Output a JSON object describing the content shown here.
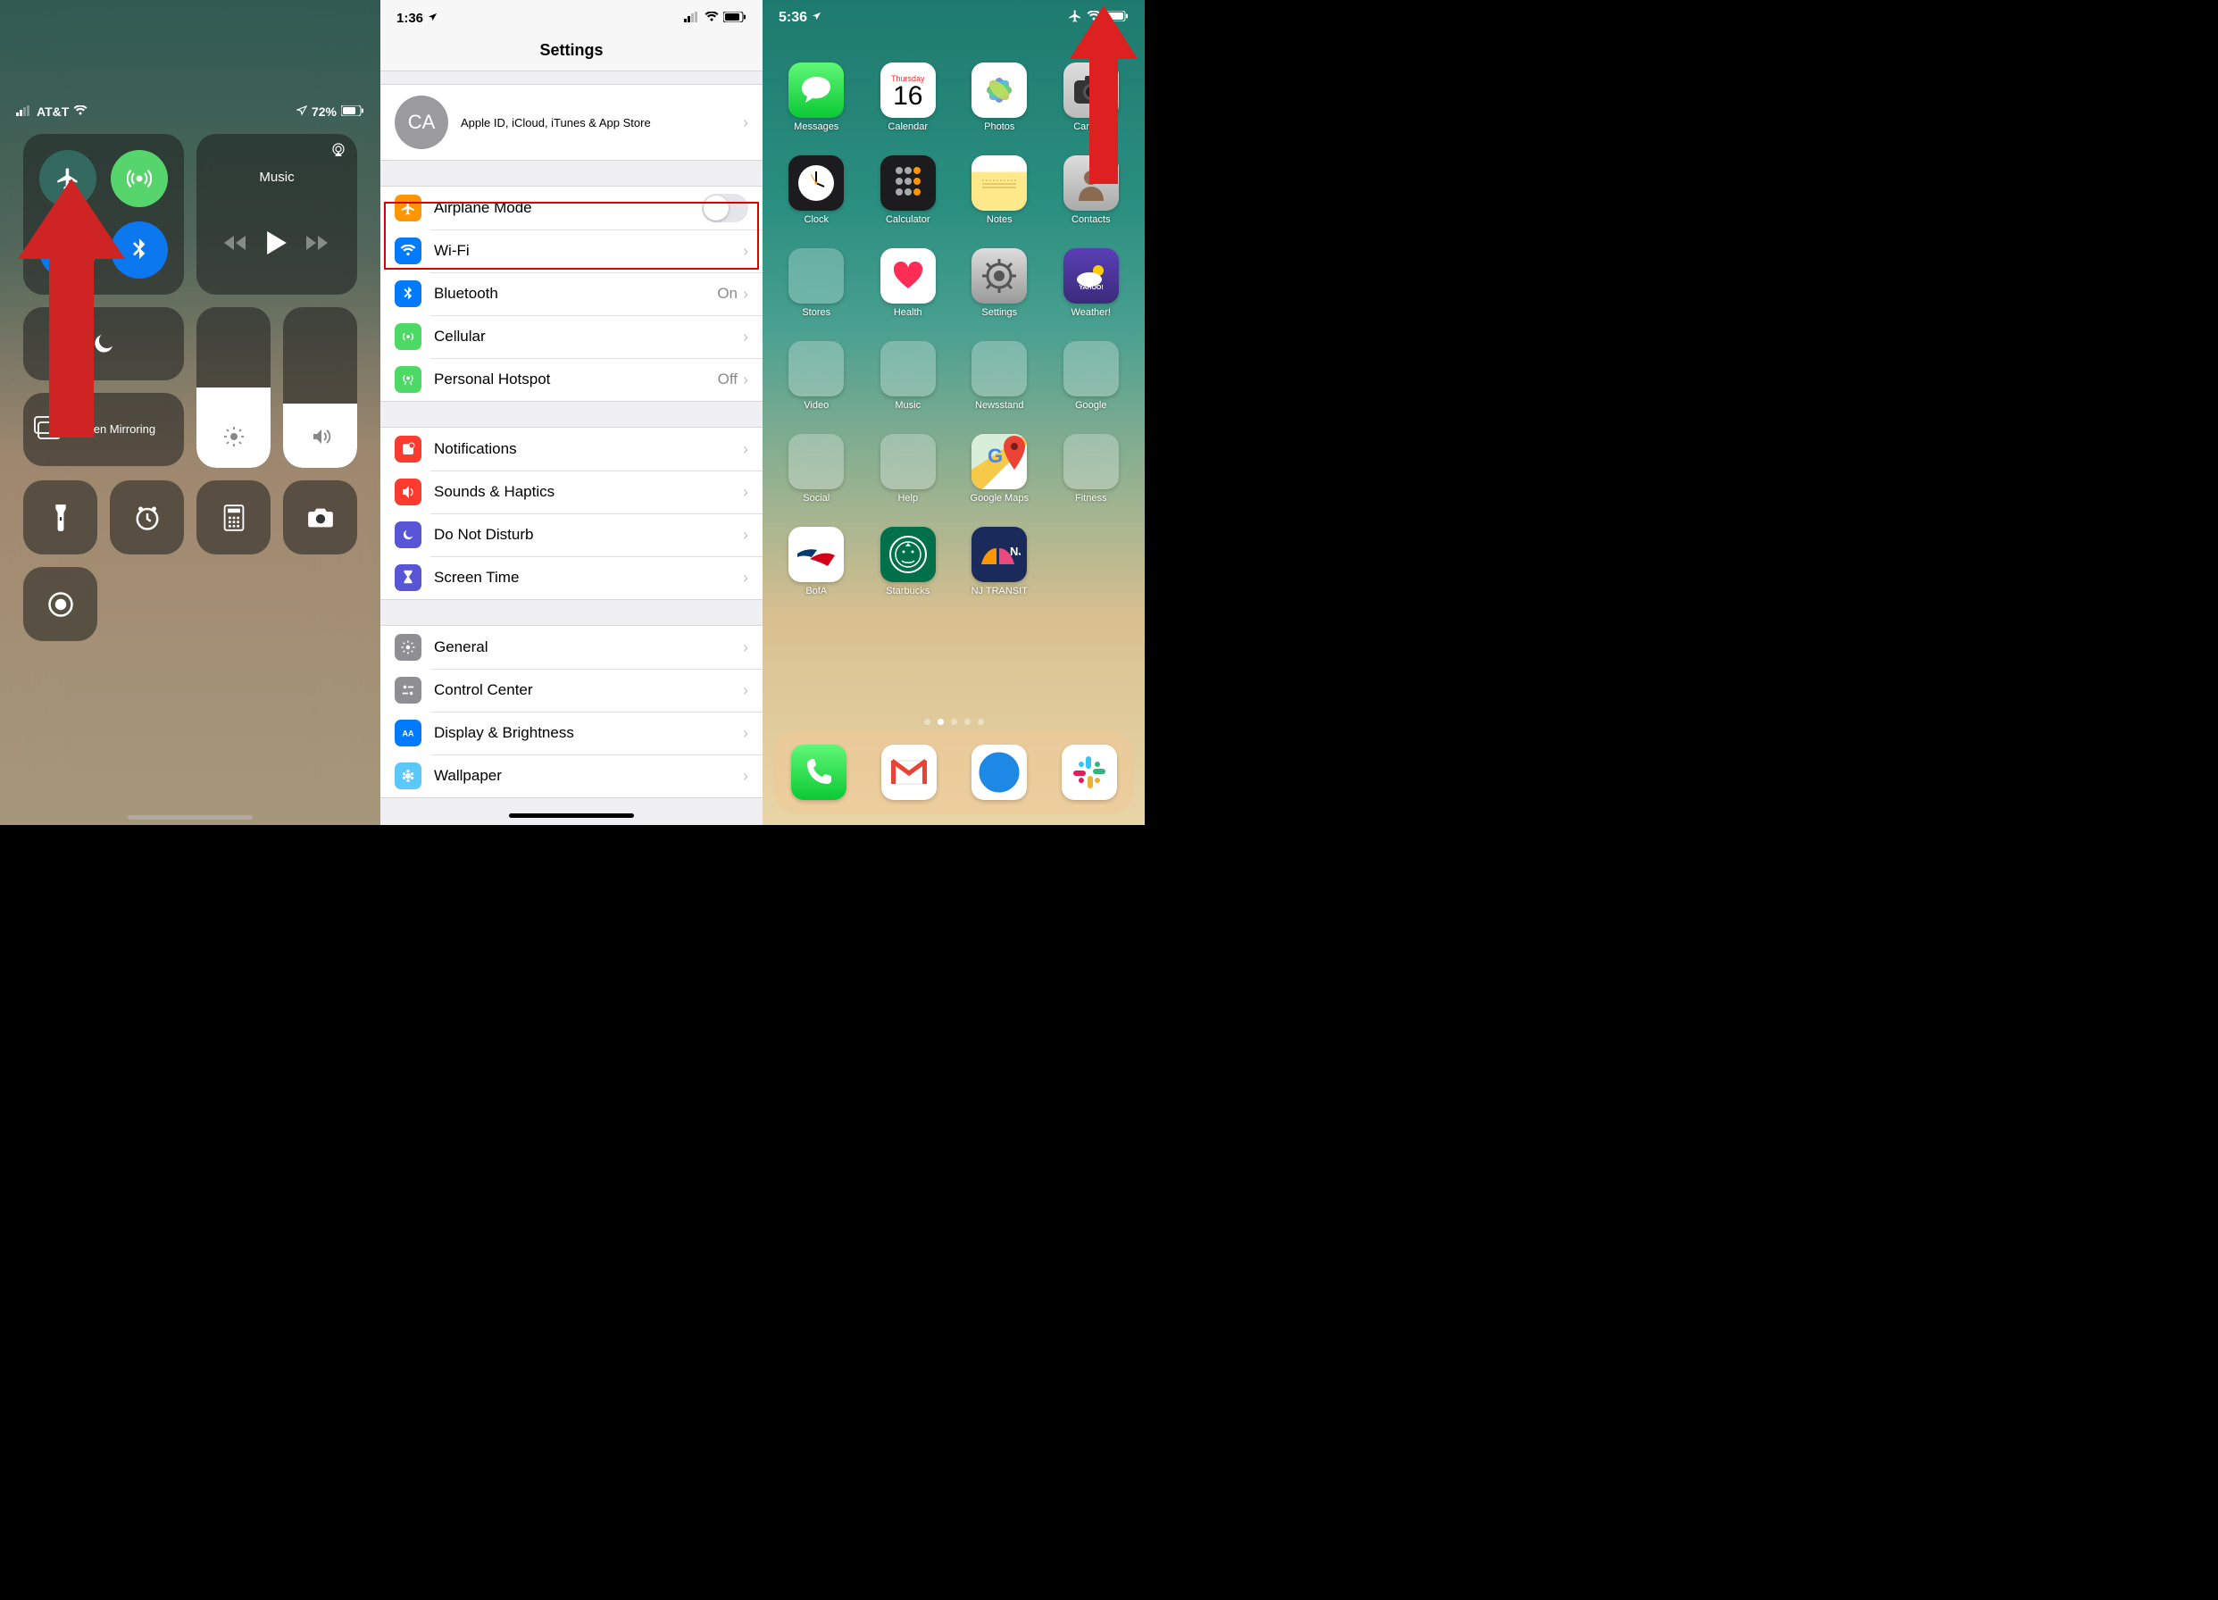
{
  "panel1": {
    "status": {
      "carrier": "AT&T",
      "battery": "72%"
    },
    "music_label": "Music",
    "mirror_label": "Screen Mirroring",
    "brightness_pct": 50,
    "volume_pct": 40
  },
  "panel2": {
    "status_time": "1:36",
    "title": "Settings",
    "account": {
      "initials": "CA",
      "subtitle": "Apple ID, iCloud, iTunes & App Store"
    },
    "rows_g1": [
      {
        "icon_bg": "#ff9500",
        "name": "airplane-mode",
        "label": "Airplane Mode",
        "type": "toggle"
      },
      {
        "icon_bg": "#007aff",
        "name": "wifi",
        "label": "Wi-Fi",
        "value": ""
      },
      {
        "icon_bg": "#007aff",
        "name": "bluetooth",
        "label": "Bluetooth",
        "value": "On"
      },
      {
        "icon_bg": "#4cd964",
        "name": "cellular",
        "label": "Cellular",
        "value": ""
      },
      {
        "icon_bg": "#4cd964",
        "name": "hotspot",
        "label": "Personal Hotspot",
        "value": "Off"
      }
    ],
    "rows_g2": [
      {
        "icon_bg": "#ff3b30",
        "name": "notifications",
        "label": "Notifications"
      },
      {
        "icon_bg": "#ff3b30",
        "name": "sounds",
        "label": "Sounds & Haptics"
      },
      {
        "icon_bg": "#5856d6",
        "name": "dnd",
        "label": "Do Not Disturb"
      },
      {
        "icon_bg": "#5856d6",
        "name": "screen-time",
        "label": "Screen Time"
      }
    ],
    "rows_g3": [
      {
        "icon_bg": "#8e8e93",
        "name": "general",
        "label": "General"
      },
      {
        "icon_bg": "#8e8e93",
        "name": "control-center",
        "label": "Control Center"
      },
      {
        "icon_bg": "#007aff",
        "name": "display",
        "label": "Display & Brightness"
      },
      {
        "icon_bg": "#5ac8fa",
        "name": "wallpaper",
        "label": "Wallpaper"
      }
    ]
  },
  "panel3": {
    "status_time": "5:36",
    "calendar": {
      "weekday": "Thursday",
      "day": "16"
    },
    "apps_r1": [
      "Messages",
      "Calendar",
      "Photos",
      "Camera"
    ],
    "apps_r2": [
      "Clock",
      "Calculator",
      "Notes",
      "Contacts"
    ],
    "apps_r3": [
      "Stores",
      "Health",
      "Settings",
      "Weather!"
    ],
    "apps_r4": [
      "Video",
      "Music",
      "Newsstand",
      "Google"
    ],
    "apps_r5": [
      "Social",
      "Help",
      "Google Maps",
      "Fitness"
    ],
    "apps_r6": [
      "BofA",
      "Starbucks",
      "NJ TRANSIT"
    ],
    "dock": [
      "Phone",
      "Gmail",
      "Safari",
      "Slack"
    ]
  }
}
